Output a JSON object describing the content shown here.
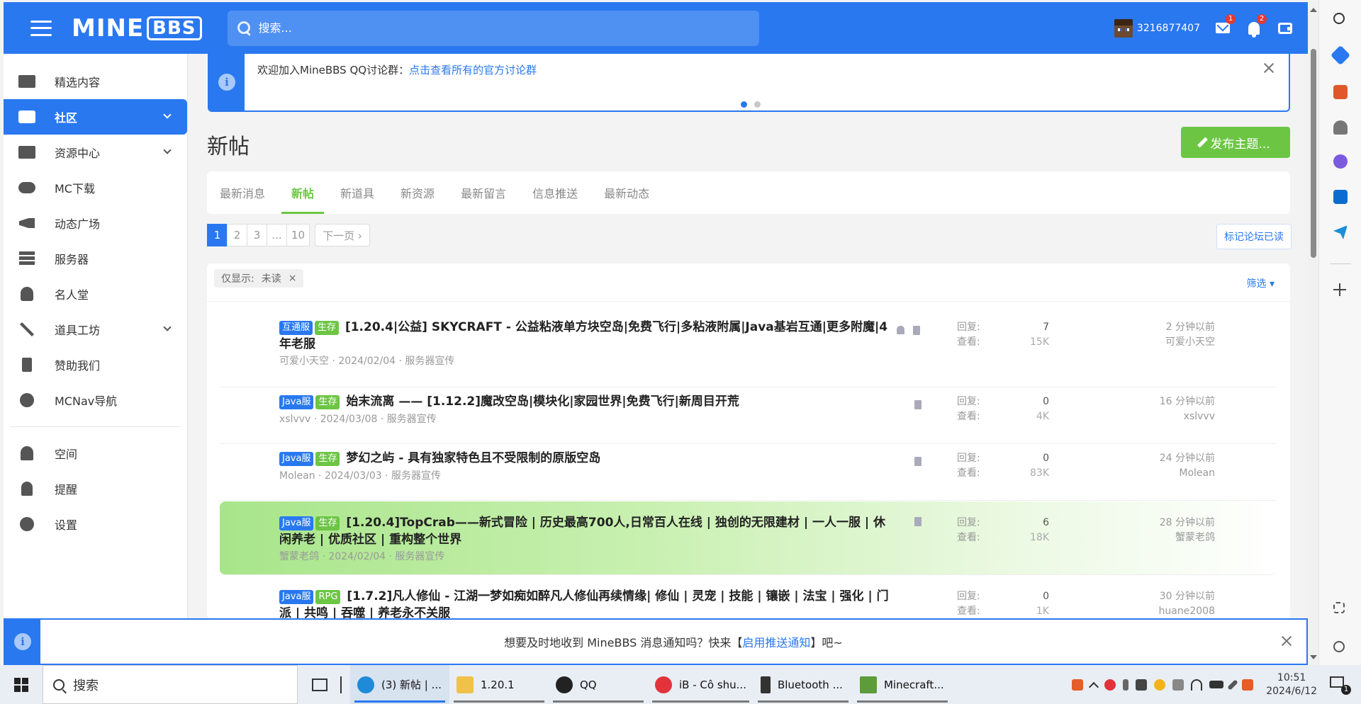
{
  "header": {
    "logo_main": "MINE",
    "logo_box": "BBS",
    "search_placeholder": "搜索...",
    "username": "3216877407",
    "mail_badge": "1",
    "alert_badge": "2"
  },
  "sidebar": {
    "items": [
      {
        "label": "精选内容"
      },
      {
        "label": "社区"
      },
      {
        "label": "资源中心"
      },
      {
        "label": "MC下载"
      },
      {
        "label": "动态广场"
      },
      {
        "label": "服务器"
      },
      {
        "label": "名人堂"
      },
      {
        "label": "道具工坊"
      },
      {
        "label": "赞助我们"
      },
      {
        "label": "MCNav导航"
      }
    ],
    "account": [
      {
        "label": "空间"
      },
      {
        "label": "提醒"
      },
      {
        "label": "设置"
      }
    ]
  },
  "notice": {
    "text": "欢迎加入MineBBS QQ讨论群：",
    "link": "点击查看所有的官方讨论群"
  },
  "page": {
    "title": "新帖",
    "post_button": "发布主题...",
    "mark_read": "标记论坛已读"
  },
  "tabs": [
    "最新消息",
    "新帖",
    "新道具",
    "新资源",
    "最新留言",
    "信息推送",
    "最新动态"
  ],
  "pager": {
    "pages": [
      "1",
      "2",
      "3",
      "...",
      "10"
    ],
    "next": "下一页 ›"
  },
  "filter": {
    "prefix": "仅显示:",
    "value": "未读",
    "remove": "×",
    "link": "筛选 ▾"
  },
  "stats_labels": {
    "replies": "回复:",
    "views": "查看:"
  },
  "threads": [
    {
      "labels": [
        "互通服",
        "生存"
      ],
      "title": "[1.20.4|公益] SKYCRAFT - 公益粘液单方块空岛|免费飞行|多粘液附属|Java基岩互通|更多附魔|4年老服",
      "author": "可爱小天空",
      "date": "2024/02/04",
      "forum": "服务器宣传",
      "replies": "7",
      "views": "15K",
      "last_time": "2 分钟以前",
      "last_user": "可爱小天空"
    },
    {
      "labels": [
        "Java服",
        "生存"
      ],
      "title": "始末流离 —— [1.12.2]魔改空岛|模块化|家园世界|免费飞行|新周目开荒",
      "author": "xslvvv",
      "date": "2024/03/08",
      "forum": "服务器宣传",
      "replies": "0",
      "views": "4K",
      "last_time": "16 分钟以前",
      "last_user": "xslvvv"
    },
    {
      "labels": [
        "Java服",
        "生存"
      ],
      "title": "梦幻之屿 - 具有独家特色且不受限制的原版空岛",
      "author": "Molean",
      "date": "2024/03/03",
      "forum": "服务器宣传",
      "replies": "0",
      "views": "83K",
      "last_time": "24 分钟以前",
      "last_user": "Molean"
    },
    {
      "labels": [
        "Java服",
        "生存"
      ],
      "title": "[1.20.4]TopCrab——新式冒险 | 历史最高700人,日常百人在线 | 独创的无限建材 | 一人一服 | 休闲养老 | 优质社区 | 重构整个世界",
      "author": "蟹蒙老鸽",
      "date": "2024/02/04",
      "forum": "服务器宣传",
      "replies": "6",
      "views": "18K",
      "last_time": "28 分钟以前",
      "last_user": "蟹蒙老鸽"
    },
    {
      "labels": [
        "Java服",
        "RPG"
      ],
      "title": "[1.7.2]凡人修仙 - 江湖一梦如痴如醉凡人修仙再续情缘| 修仙 | 灵宠 | 技能 | 镶嵌 | 法宝 | 强化 | 门派 | 共鸣 | 吞噬 | 养老永不关服",
      "author": "",
      "date": "",
      "forum": "",
      "replies": "0",
      "views": "1K",
      "last_time": "30 分钟以前",
      "last_user": "huane2008"
    }
  ],
  "push": {
    "text_before": "想要及时地收到 MineBBS 消息通知吗？快来【",
    "link": "启用推送通知",
    "text_after": "】吧~"
  },
  "taskbar": {
    "search": "搜索",
    "apps": [
      {
        "label": "(3) 新帖 | ...",
        "color": "#1f8ad8"
      },
      {
        "label": "1.20.1",
        "color": "#f0c24a"
      },
      {
        "label": "QQ",
        "color": "#222222"
      },
      {
        "label": "iB - Cô shu...",
        "color": "#e2333a"
      },
      {
        "label": "Bluetooth ...",
        "color": "#333333"
      },
      {
        "label": "Minecraft...",
        "color": "#5c9c3a"
      }
    ],
    "time": "10:51",
    "date": "2024/6/12",
    "notif_count": "1"
  },
  "colors": {
    "primary": "#2978f0",
    "green": "#6cc644"
  }
}
